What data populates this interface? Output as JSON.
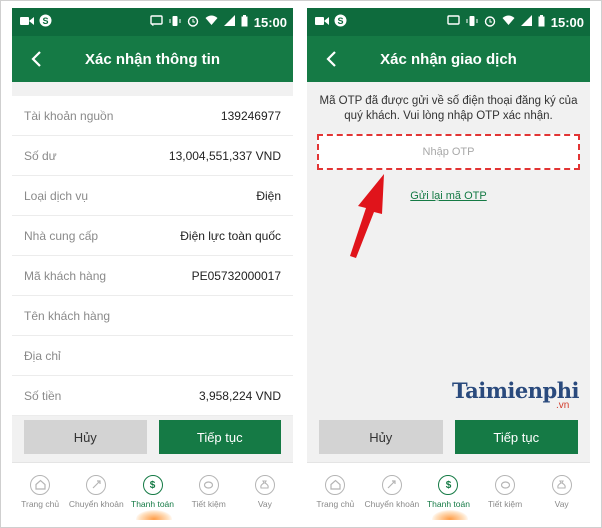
{
  "status_bar": {
    "time": "15:00"
  },
  "left_screen": {
    "header_title": "Xác nhận thông tin",
    "info_rows": [
      {
        "label": "Tài khoản nguồn",
        "value": "139246977"
      },
      {
        "label": "Số dư",
        "value": "13,004,551,337 VND"
      },
      {
        "label": "Loại dịch vụ",
        "value": "Điện"
      },
      {
        "label": "Nhà cung cấp",
        "value": "Điện lực toàn quốc"
      },
      {
        "label": "Mã khách hàng",
        "value": "PE05732000017"
      },
      {
        "label": "Tên khách hàng",
        "value": ""
      },
      {
        "label": "Địa chỉ",
        "value": ""
      },
      {
        "label": "Số tiền",
        "value": "3,958,224 VND"
      }
    ],
    "cancel_label": "Hủy",
    "next_label": "Tiếp tục"
  },
  "right_screen": {
    "header_title": "Xác nhận giao dịch",
    "otp_message": "Mã OTP đã được gửi về số điện thoại đăng ký của quý khách. Vui lòng nhập OTP xác nhận.",
    "otp_placeholder": "Nhập OTP",
    "otp_value": "",
    "resend_label": "Gửi lại mã OTP",
    "cancel_label": "Hủy",
    "next_label": "Tiếp tục"
  },
  "tabbar": {
    "items": [
      {
        "label": "Trang chủ",
        "icon": "home-icon"
      },
      {
        "label": "Chuyển khoản",
        "icon": "transfer-icon"
      },
      {
        "label": "Thanh toán",
        "icon": "dollar-icon"
      },
      {
        "label": "Tiết kiệm",
        "icon": "piggy-bank-icon"
      },
      {
        "label": "Vay",
        "icon": "money-bag-icon"
      }
    ],
    "active_index": 2
  },
  "watermark": {
    "text": "Taimienphi",
    "suffix": ".vn"
  },
  "colors": {
    "brand_green": "#157a45",
    "status_green": "#0e6b3d",
    "highlight_red": "#e23434",
    "watermark_blue": "#2a4a7d"
  }
}
